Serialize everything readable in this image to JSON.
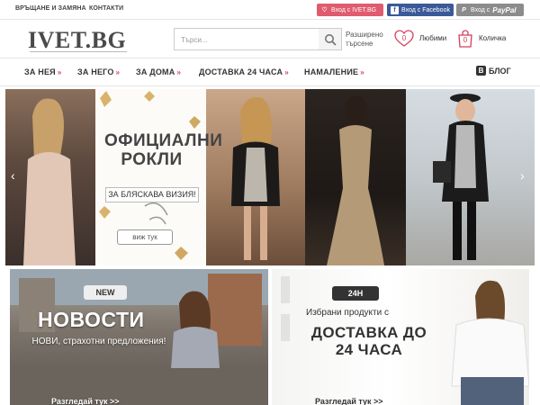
{
  "topbar": {
    "links": [
      "ВРЪЩАНЕ И ЗАМЯНА",
      "КОНТАКТИ"
    ],
    "login_ivet": "Вход с IVET.BG",
    "login_fb": "Вход с Facebook",
    "login_pp_prefix": "Вход с",
    "login_pp_brand": "PayPal"
  },
  "header": {
    "logo": "IVET.BG",
    "search_placeholder": "Търси...",
    "advanced_search": [
      "Разширено",
      "търсене"
    ],
    "favorites_label": "Любими",
    "favorites_count": "0",
    "cart_label": "Количка",
    "cart_count": "0"
  },
  "nav": {
    "items": [
      "ЗА НЕЯ",
      "ЗА НЕГО",
      "ЗА ДОМА",
      "ДОСТАВКА 24 ЧАСА",
      "НАМАЛЕНИЕ"
    ],
    "arrow": "»",
    "blog": "БЛОГ"
  },
  "hero": {
    "title": "ОФИЦИАЛНИ РОКЛИ",
    "tagline": "ЗА БЛЯСКАВА ВИЗИЯ!",
    "button": "виж тук",
    "prev": "‹",
    "next": "›"
  },
  "promo_left": {
    "badge": "NEW",
    "title": "НОВОСТИ",
    "subtitle": "НОВИ, страхотни предложения!",
    "link": "Разгледай тук >>"
  },
  "promo_right": {
    "badge": "24H",
    "pretitle": "Избрани продукти с",
    "title": "ДОСТАВКА ДО 24 ЧАСА",
    "link": "Разгледай тук >>"
  },
  "colors": {
    "accent": "#d43f5b",
    "facebook": "#3b5998",
    "paypal_bg": "#8c8c8c",
    "ivet_login": "#e05b6e"
  }
}
